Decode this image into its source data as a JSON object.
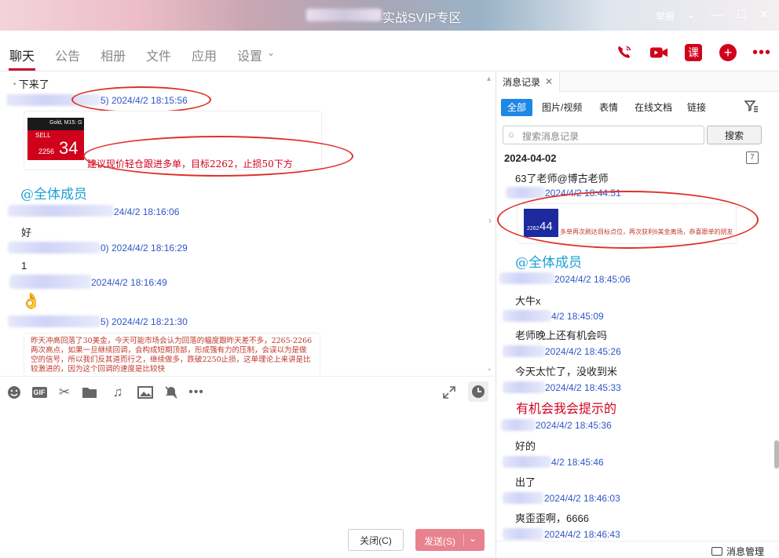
{
  "window": {
    "title": "实战SVIP专区",
    "help": "举报"
  },
  "tabs": [
    {
      "label": "聊天"
    },
    {
      "label": "公告"
    },
    {
      "label": "相册"
    },
    {
      "label": "文件"
    },
    {
      "label": "应用"
    },
    {
      "label": "设置"
    }
  ],
  "chat": {
    "top_line": "下来了",
    "messages": [
      {
        "timestamp": "2024/4/2 18:15:56",
        "partial_id": "5)"
      },
      {
        "image_card": {
          "chart_tag": "Gold, M15: G",
          "sell_label": "SELL",
          "price_small": "2256",
          "price_big": "34",
          "advice": "建议现价轻仓跟进多单，目标2262，止损50下方"
        }
      },
      {
        "mention": "@全体成员"
      },
      {
        "timestamp": "24/4/2 18:16:06"
      },
      {
        "text": "好"
      },
      {
        "timestamp": "2024/4/2 18:16:29",
        "partial_id": "0)"
      },
      {
        "text": "1"
      },
      {
        "timestamp": "2024/4/2 18:16:49"
      },
      {
        "timestamp": "2024/4/2 18:21:30",
        "partial_id": "5)"
      },
      {
        "note": "昨天冲高回落了30美金，今天可能市场会认为回落的幅度跟昨天差不多，2265-2266两次高点，如果一旦继续回调，会构成短期顶部，形成强有力的压制，会误以为是做空的信号，所以我们反其道而行之，继续做多，跌破2250止损，这单理论上来讲是比较激进的，因为这个回调的速度是比较快"
      }
    ]
  },
  "toolbar": {
    "icons": [
      "emoji-icon",
      "gif-icon",
      "scissors-icon",
      "folder-icon",
      "music-icon",
      "image-icon",
      "bell-off-icon",
      "more-icon",
      "expand-icon",
      "clock-icon"
    ]
  },
  "buttons": {
    "close": "关闭(C)",
    "send": "发送(S)"
  },
  "history": {
    "tab_title": "消息记录",
    "filters": [
      "全部",
      "图片/视频",
      "表情",
      "在线文档",
      "链接"
    ],
    "search_placeholder": "搜索消息记录",
    "search_button": "搜索",
    "date": "2024-04-02",
    "items": [
      {
        "text": "63了老师@博古老师",
        "ts": "2024/4/2 18:44:51"
      },
      {
        "card": {
          "price_small": "2262",
          "price_big": "44",
          "advice": "多单再次刷达目标点位，再次获利6美金离场，恭喜跟单的朋友"
        }
      },
      {
        "mention": "@全体成员",
        "ts": "2024/4/2 18:45:06"
      },
      {
        "text": "大牛x",
        "ts": "4/2 18:45:09"
      },
      {
        "text": "老师晚上还有机会吗",
        "ts": "2024/4/2 18:45:26"
      },
      {
        "text": "今天太忙了，没收到米",
        "ts": "2024/4/2 18:45:33"
      },
      {
        "mention": "有机会我会提示的",
        "ts": "2024/4/2 18:45:36"
      },
      {
        "text": "好的",
        "ts": "4/2 18:45:46"
      },
      {
        "text": "出了",
        "ts": "2024/4/2 18:46:03"
      },
      {
        "text": "爽歪歪啊，6666",
        "ts": "2024/4/2 18:46:43"
      }
    ],
    "footer": "消息管理"
  },
  "colors": {
    "accent": "#d0021b",
    "link": "#2f57c8",
    "mention": "#1ea0d8",
    "annotation": "#e0302a"
  }
}
